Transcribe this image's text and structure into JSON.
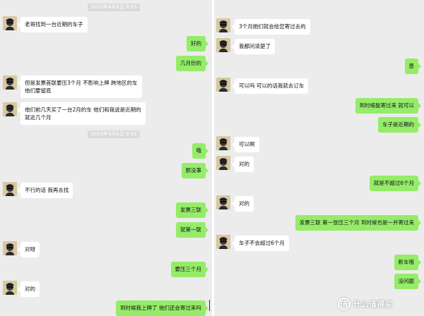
{
  "colors": {
    "panel_bg": "#ececec",
    "incoming_bubble": "#ffffff",
    "outgoing_bubble": "#95ec69",
    "timestamp_bg": "#dadada"
  },
  "left": {
    "timestamps": [
      "2022年4月6日 9:53",
      "2022年4月6日 9:55"
    ],
    "messages": [
      {
        "dir": "in",
        "text": "老哥找到一台近期的车子"
      },
      {
        "dir": "out",
        "text": "好的"
      },
      {
        "dir": "out",
        "text": "几月份的"
      },
      {
        "dir": "in",
        "text": "但是发票首联要压3个月  不影响上牌  跨地区的车"
      },
      {
        "dir": "in",
        "text": "他们要留底"
      },
      {
        "dir": "in",
        "text": "他们前几天买了一台2月的车  他们和我说是近期的"
      },
      {
        "dir": "in",
        "text": "就这几个月"
      },
      {
        "dir": "out",
        "text": "哦"
      },
      {
        "dir": "out",
        "text": "那没事"
      },
      {
        "dir": "in",
        "text": "不行的话 我再去找"
      },
      {
        "dir": "out",
        "text": "发票三联"
      },
      {
        "dir": "out",
        "text": "就第一联"
      },
      {
        "dir": "in",
        "text": "对呀"
      },
      {
        "dir": "out",
        "text": "要压三个月"
      },
      {
        "dir": "in",
        "text": "对的"
      },
      {
        "dir": "out",
        "text": "到时候我上牌了 他们还会寄过来吗"
      }
    ]
  },
  "right": {
    "messages": [
      {
        "dir": "in",
        "text": "3个月她们就会给您寄过去的"
      },
      {
        "dir": "in",
        "text": "我都问清楚了"
      },
      {
        "dir": "out",
        "text": "恩"
      },
      {
        "dir": "in",
        "text": "可以吗  可以的话我就去订车"
      },
      {
        "dir": "out",
        "text": "到时候能寄过来 就可以"
      },
      {
        "dir": "out",
        "text": "车子是近期的"
      },
      {
        "dir": "in",
        "text": "可以啊"
      },
      {
        "dir": "in",
        "text": "对的"
      },
      {
        "dir": "out",
        "text": "就是不超过6个月"
      },
      {
        "dir": "in",
        "text": "对的"
      },
      {
        "dir": "out",
        "text": "发票三联 第一张压三个月 到时候也是一并寄过来"
      },
      {
        "dir": "in",
        "text": "车子不会超过6个月"
      },
      {
        "dir": "out",
        "text": "新车哦"
      },
      {
        "dir": "out",
        "text": "没问题"
      }
    ]
  },
  "watermark": {
    "icon": "值",
    "text": "什么值得买"
  }
}
